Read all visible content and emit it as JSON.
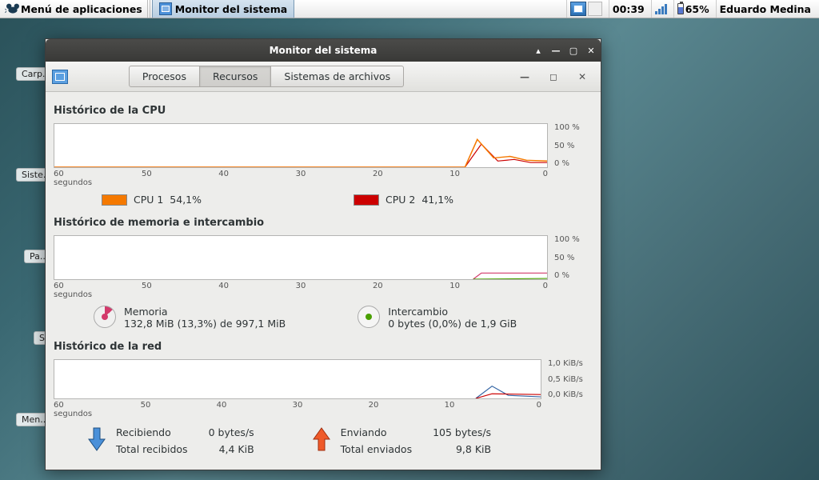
{
  "panel": {
    "app_menu": "Menú de aplicaciones",
    "task": "Monitor del sistema",
    "clock": "00:39",
    "battery_pct": "65%",
    "user": "Eduardo Medina"
  },
  "desktop_icons": [
    "Carp...",
    "Siste...",
    "Pa...",
    "S",
    "Men..."
  ],
  "window": {
    "title": "Monitor del sistema",
    "tabs": {
      "processes": "Procesos",
      "resources": "Recursos",
      "filesystems": "Sistemas de archivos"
    }
  },
  "cpu": {
    "heading": "Histórico de la CPU",
    "x_ticks": [
      "60 segundos",
      "50",
      "40",
      "30",
      "20",
      "10",
      "0"
    ],
    "y_ticks": [
      "100 %",
      "50 %",
      "0 %"
    ],
    "legend": [
      {
        "label": "CPU 1",
        "value": "54,1%",
        "color": "#f57900"
      },
      {
        "label": "CPU 2",
        "value": "41,1%",
        "color": "#cc0000"
      }
    ]
  },
  "mem": {
    "heading": "Histórico de memoria e intercambio",
    "x_ticks": [
      "60 segundos",
      "50",
      "40",
      "30",
      "20",
      "10",
      "0"
    ],
    "y_ticks": [
      "100 %",
      "50 %",
      "0 %"
    ],
    "memory": {
      "label": "Memoria",
      "detail": "132,8 MiB (13,3%) de 997,1 MiB",
      "color": "#d33a6b"
    },
    "swap": {
      "label": "Intercambio",
      "detail": "0 bytes (0,0%) de 1,9 GiB",
      "color": "#4aa000"
    }
  },
  "net": {
    "heading": "Histórico de la red",
    "x_ticks": [
      "60 segundos",
      "50",
      "40",
      "30",
      "20",
      "10",
      "0"
    ],
    "y_ticks": [
      "1,0 KiB/s",
      "0,5 KiB/s",
      "0,0 KiB/s"
    ],
    "recv": {
      "label": "Recibiendo",
      "rate": "0 bytes/s",
      "total_label": "Total recibidos",
      "total": "4,4 KiB"
    },
    "send": {
      "label": "Enviando",
      "rate": "105 bytes/s",
      "total_label": "Total enviados",
      "total": "9,8 KiB"
    }
  },
  "chart_data": [
    {
      "type": "line",
      "title": "Histórico de la CPU",
      "xlabel": "segundos",
      "ylabel": "%",
      "ylim": [
        0,
        100
      ],
      "x": [
        60,
        50,
        40,
        30,
        20,
        10,
        0
      ],
      "series": [
        {
          "name": "CPU 1",
          "color": "#f57900",
          "values": [
            0,
            0,
            0,
            0,
            0,
            54,
            20
          ]
        },
        {
          "name": "CPU 2",
          "color": "#cc0000",
          "values": [
            0,
            0,
            0,
            0,
            0,
            41,
            15
          ]
        }
      ]
    },
    {
      "type": "line",
      "title": "Histórico de memoria e intercambio",
      "xlabel": "segundos",
      "ylabel": "%",
      "ylim": [
        0,
        100
      ],
      "x": [
        60,
        50,
        40,
        30,
        20,
        10,
        0
      ],
      "series": [
        {
          "name": "Memoria",
          "color": "#d33a6b",
          "values": [
            0,
            0,
            0,
            0,
            0,
            13,
            13.3
          ]
        },
        {
          "name": "Intercambio",
          "color": "#4aa000",
          "values": [
            0,
            0,
            0,
            0,
            0,
            0,
            0
          ]
        }
      ]
    },
    {
      "type": "line",
      "title": "Histórico de la red",
      "xlabel": "segundos",
      "ylabel": "KiB/s",
      "ylim": [
        0,
        1.0
      ],
      "x": [
        60,
        50,
        40,
        30,
        20,
        10,
        0
      ],
      "series": [
        {
          "name": "Recibiendo",
          "color": "#3465a4",
          "values": [
            0,
            0,
            0,
            0,
            0,
            0.3,
            0.05
          ]
        },
        {
          "name": "Enviando",
          "color": "#cc0000",
          "values": [
            0,
            0,
            0,
            0,
            0,
            0.1,
            0.1
          ]
        }
      ]
    }
  ]
}
